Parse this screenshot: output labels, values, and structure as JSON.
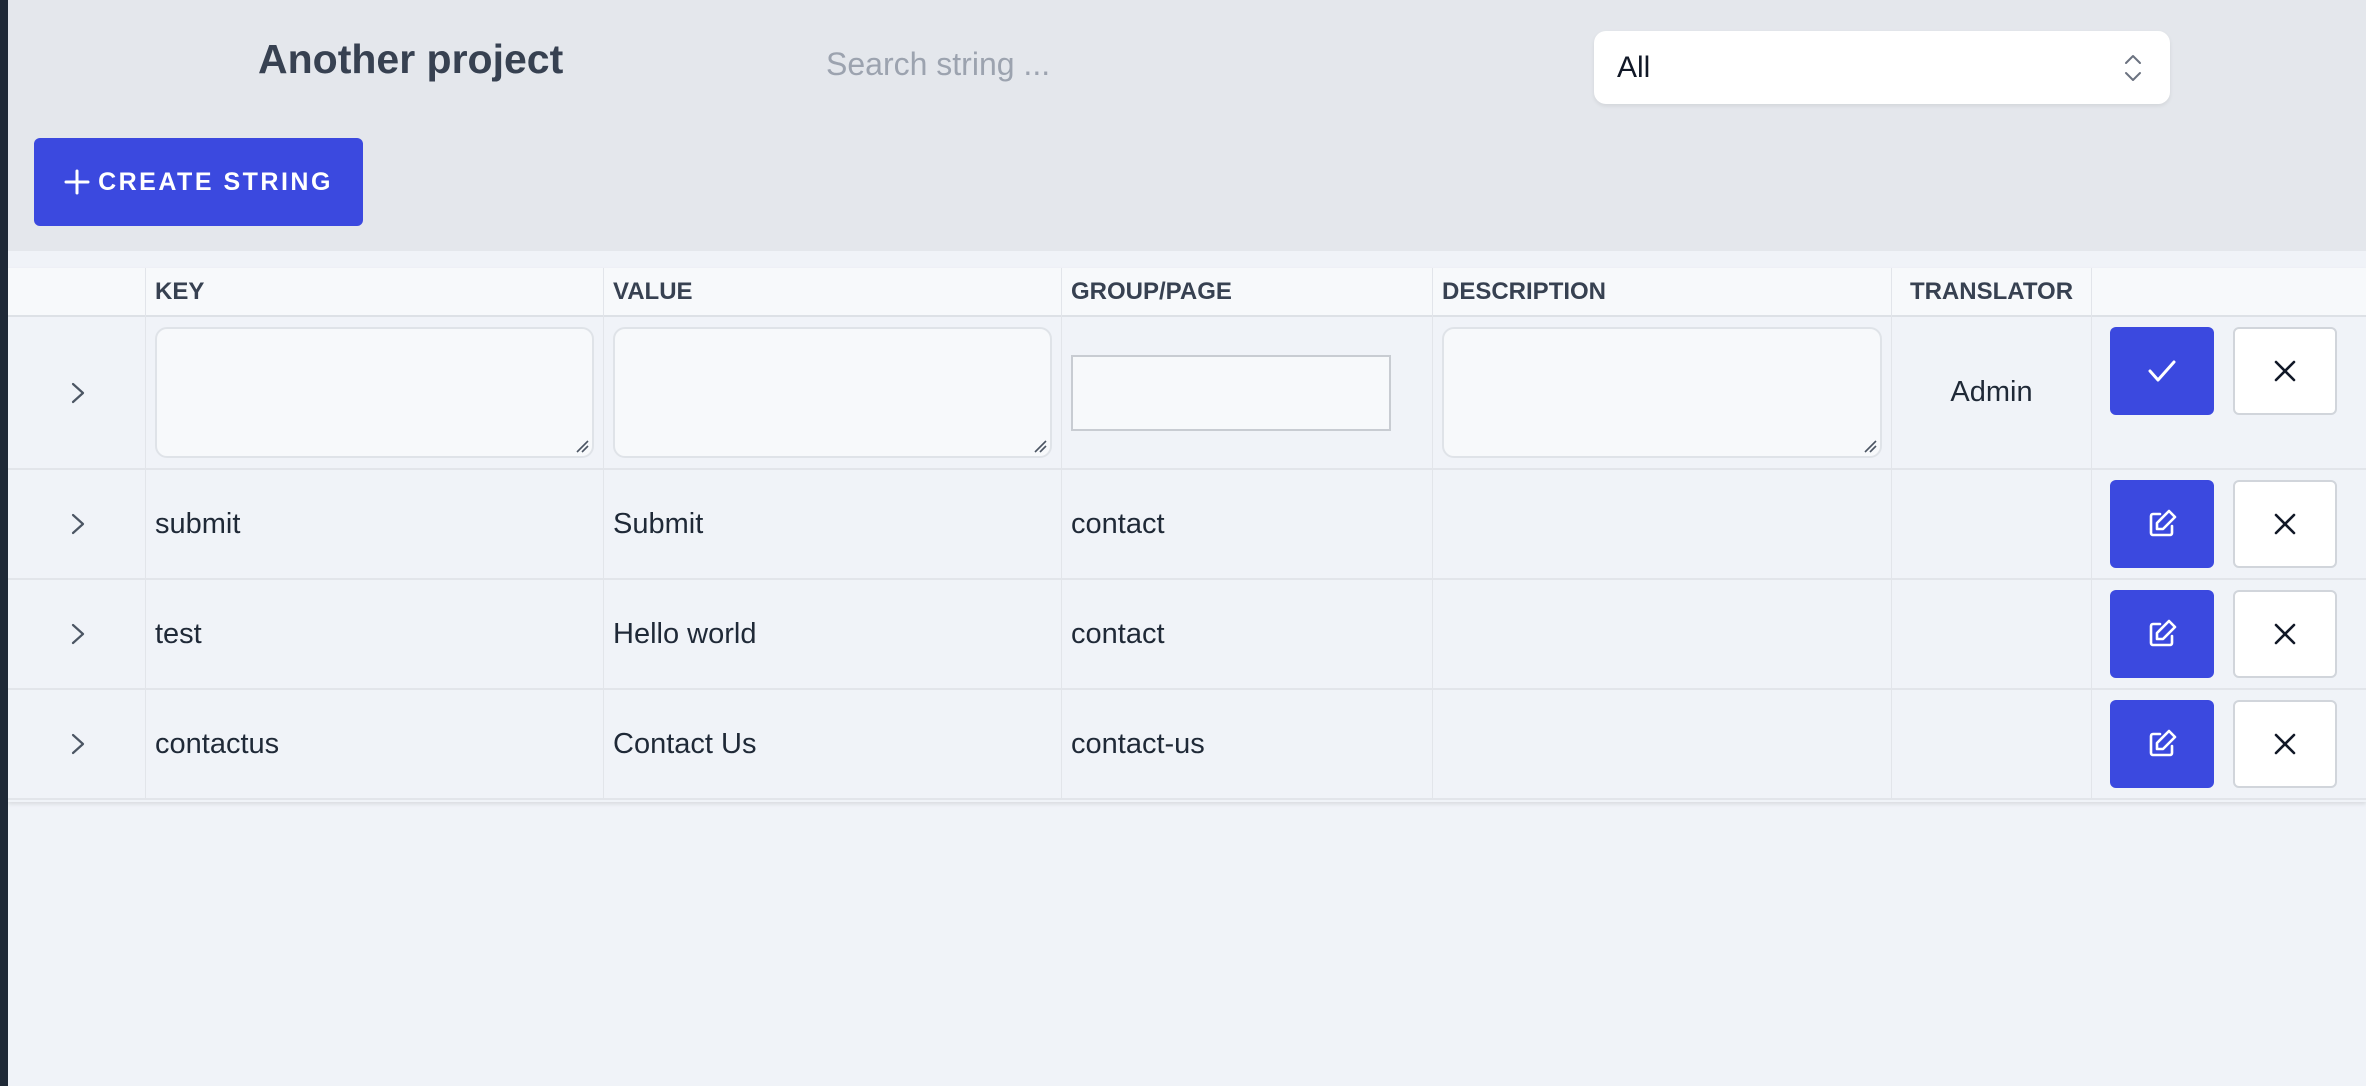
{
  "header": {
    "project_title": "Another project",
    "search_placeholder": "Search string ...",
    "filter_select": {
      "selected": "All"
    },
    "create_button_label": "CREATE STRING"
  },
  "table": {
    "columns": [
      "KEY",
      "VALUE",
      "GROUP/PAGE",
      "DESCRIPTION",
      "TRANSLATOR"
    ],
    "new_row": {
      "translator": "Admin"
    },
    "rows": [
      {
        "key": "submit",
        "value": "Submit",
        "group": "contact",
        "description": "",
        "translator": ""
      },
      {
        "key": "test",
        "value": "Hello world",
        "group": "contact",
        "description": "",
        "translator": ""
      },
      {
        "key": "contactus",
        "value": "Contact Us",
        "group": "contact-us",
        "description": "",
        "translator": ""
      }
    ]
  },
  "icons": {
    "expand": "chevron-right-icon",
    "confirm": "check-icon",
    "edit": "edit-icon",
    "delete": "close-icon",
    "create": "plus-icon",
    "select": "select-arrows-icon"
  },
  "colors": {
    "accent": "#3b49df",
    "header_bg": "#e4e7ec",
    "page_bg": "#f0f3f8",
    "text": "#374151"
  }
}
